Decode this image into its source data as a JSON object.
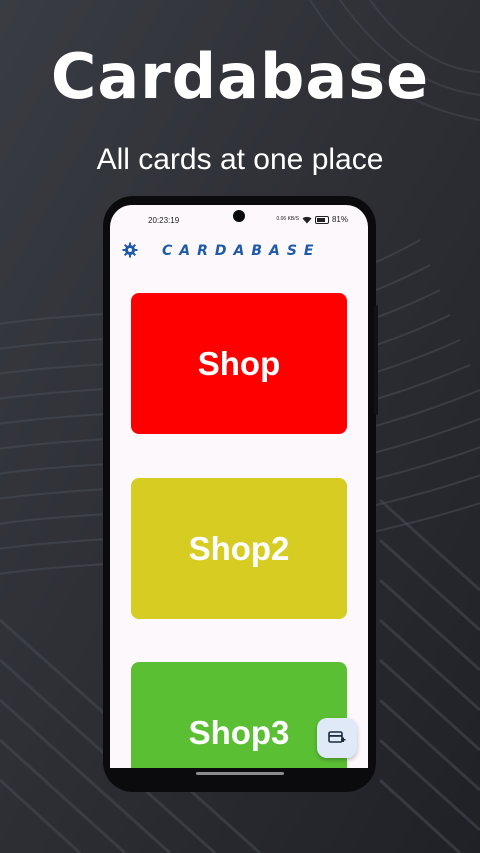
{
  "banner": {
    "title": "Cardabase",
    "tagline": "All cards at one place"
  },
  "status_bar": {
    "time": "20:23:19",
    "network_speed": "0.06 KB/S",
    "battery": "81%"
  },
  "app_bar": {
    "logo": "CARDABASE",
    "settings_icon": "gear-icon"
  },
  "cards": [
    {
      "label": "Shop",
      "color": "#ff0000"
    },
    {
      "label": "Shop2",
      "color": "#d6cc22"
    },
    {
      "label": "Shop3",
      "color": "#5bbf34"
    }
  ],
  "fab": {
    "icon": "add-card-icon"
  },
  "colors": {
    "background": "#2b2d33",
    "logo_blue": "#1f5aa8",
    "fab_background": "#dfe9f7"
  }
}
